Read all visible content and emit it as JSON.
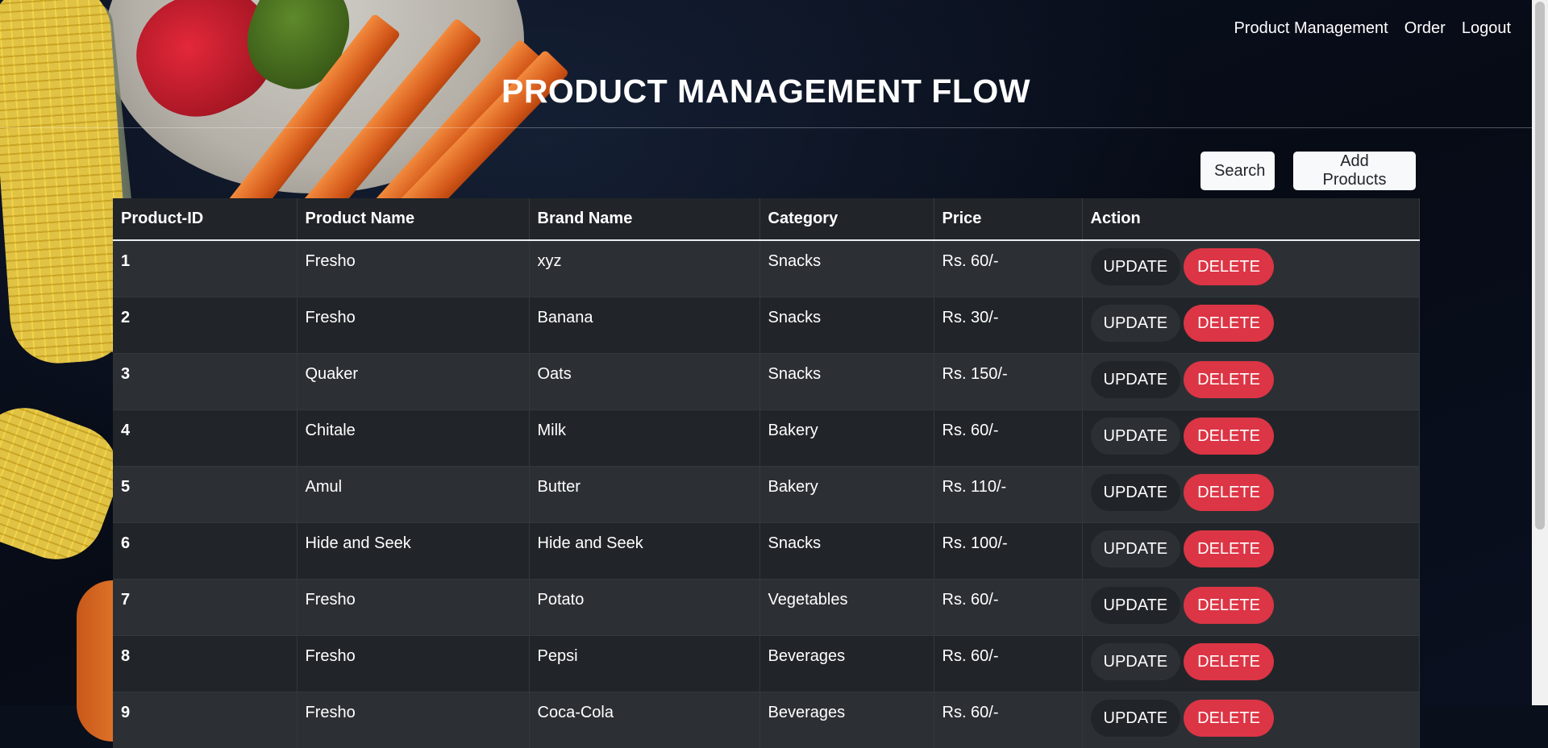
{
  "nav": {
    "items": [
      "Product Management",
      "Order",
      "Logout"
    ]
  },
  "page_title": "PRODUCT MANAGEMENT FLOW",
  "toolbar": {
    "search_label": "Search",
    "add_label": "Add Products"
  },
  "table": {
    "headers": [
      "Product-ID",
      "Product Name",
      "Brand Name",
      "Category",
      "Price",
      "Action"
    ],
    "update_label": "UPDATE",
    "delete_label": "DELETE",
    "rows": [
      {
        "id": "1",
        "product": "Fresho",
        "brand": "xyz",
        "category": "Snacks",
        "price": "Rs. 60/-"
      },
      {
        "id": "2",
        "product": "Fresho",
        "brand": "Banana",
        "category": "Snacks",
        "price": "Rs. 30/-"
      },
      {
        "id": "3",
        "product": "Quaker",
        "brand": "Oats",
        "category": "Snacks",
        "price": "Rs. 150/-"
      },
      {
        "id": "4",
        "product": "Chitale",
        "brand": "Milk",
        "category": "Bakery",
        "price": "Rs. 60/-"
      },
      {
        "id": "5",
        "product": "Amul",
        "brand": "Butter",
        "category": "Bakery",
        "price": "Rs. 110/-"
      },
      {
        "id": "6",
        "product": "Hide and Seek",
        "brand": "Hide and Seek",
        "category": "Snacks",
        "price": "Rs. 100/-"
      },
      {
        "id": "7",
        "product": "Fresho",
        "brand": "Potato",
        "category": "Vegetables",
        "price": "Rs. 60/-"
      },
      {
        "id": "8",
        "product": "Fresho",
        "brand": "Pepsi",
        "category": "Beverages",
        "price": "Rs. 60/-"
      },
      {
        "id": "9",
        "product": "Fresho",
        "brand": "Coca-Cola",
        "category": "Beverages",
        "price": "Rs. 60/-"
      }
    ]
  },
  "colors": {
    "delete": "#dc3545",
    "table_dark": "#212529",
    "table_stripe": "#2c3034",
    "light_button": "#f8f9fa"
  }
}
